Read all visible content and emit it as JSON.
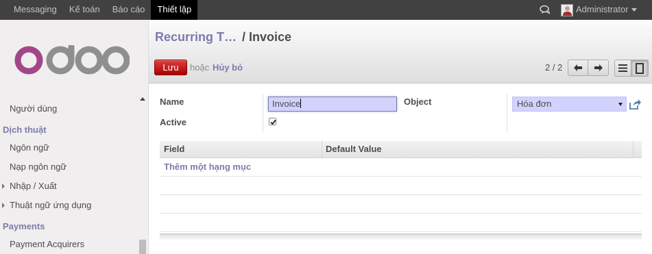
{
  "topbar": {
    "menu": [
      "Messaging",
      "Kế toán",
      "Báo cáo",
      "Thiết lập"
    ],
    "active_menu": "Thiết lập",
    "user": "Administrator"
  },
  "sidebar": {
    "logo": "odoo",
    "items": [
      {
        "type": "item",
        "label": "Người dùng"
      },
      {
        "type": "header",
        "label": "Dịch thuật"
      },
      {
        "type": "item",
        "label": "Ngôn ngữ"
      },
      {
        "type": "item",
        "label": "Nạp ngôn ngữ"
      },
      {
        "type": "expandable",
        "label": "Nhập / Xuất"
      },
      {
        "type": "expandable",
        "label": "Thuật ngữ ứng dụng"
      },
      {
        "type": "header",
        "label": "Payments"
      },
      {
        "type": "item",
        "label": "Payment Acquirers"
      }
    ]
  },
  "header": {
    "breadcrumb_parent": "Recurring T…",
    "breadcrumb_sep": "/",
    "breadcrumb_current": "Invoice",
    "save_label": "Lưu",
    "or_text": "hoặc",
    "discard_label": "Hủy bỏ",
    "pager": "2 / 2"
  },
  "form": {
    "name_label": "Name",
    "name_value": "Invoice",
    "object_label": "Object",
    "object_value": "Hóa đơn",
    "active_label": "Active",
    "active_checked": true
  },
  "table": {
    "columns": [
      "Field",
      "Default Value"
    ],
    "add_line": "Thêm một hạng mục"
  },
  "colors": {
    "accent": "#7c7bad",
    "save_button": "#c40000",
    "topbar": "#414141"
  }
}
